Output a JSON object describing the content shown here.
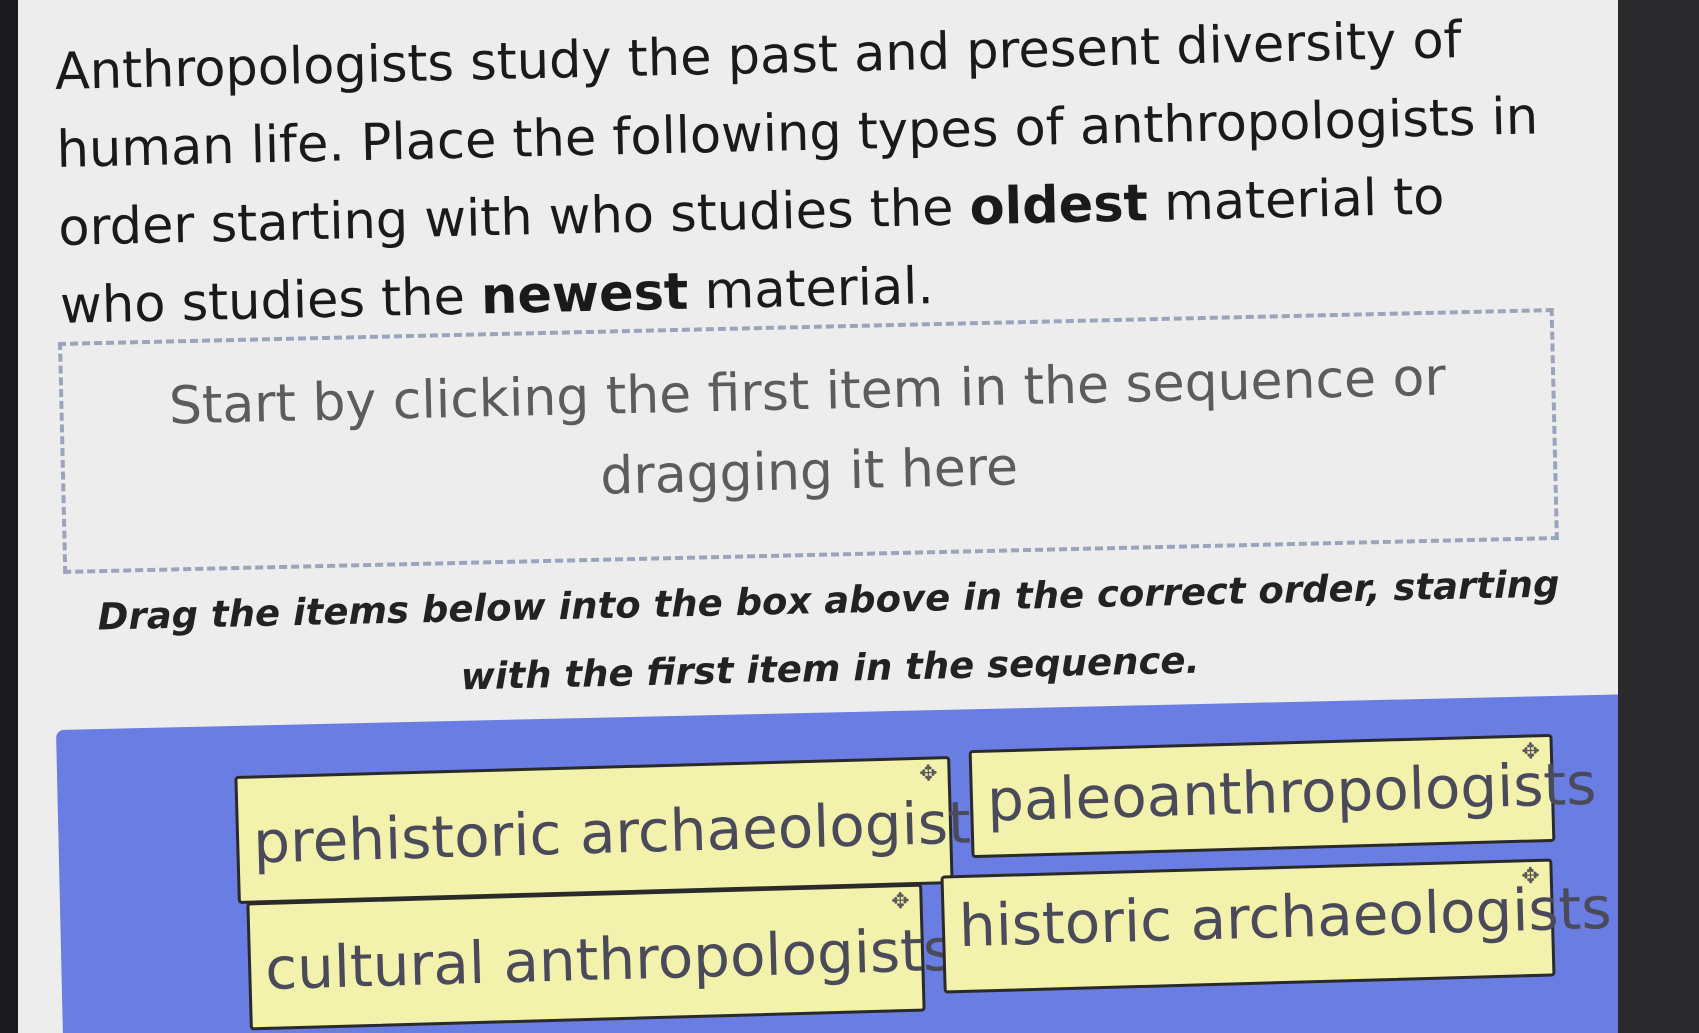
{
  "question": {
    "part1": "Anthropologists study the past and present diversity of human life. Place the following types of anthropologists in order starting with who studies the ",
    "bold1": "oldest",
    "part2": " material to who studies the ",
    "bold2": "newest",
    "part3": " material."
  },
  "drop_zone": {
    "hint": "Start by clicking the first item in the sequence or dragging it here"
  },
  "instructions": "Drag the items below into the box above in the correct order, starting with the first item in the sequence.",
  "items": [
    {
      "label": "prehistoric archaeologists",
      "icon": "move-icon"
    },
    {
      "label": "paleoanthropologists",
      "icon": "move-icon"
    },
    {
      "label": "cultural anthropologists",
      "icon": "move-icon"
    },
    {
      "label": "historic archaeologists",
      "icon": "move-icon"
    }
  ],
  "colors": {
    "tray": "#6a7de3",
    "chip": "#f3f2ac",
    "background": "#ededed"
  }
}
